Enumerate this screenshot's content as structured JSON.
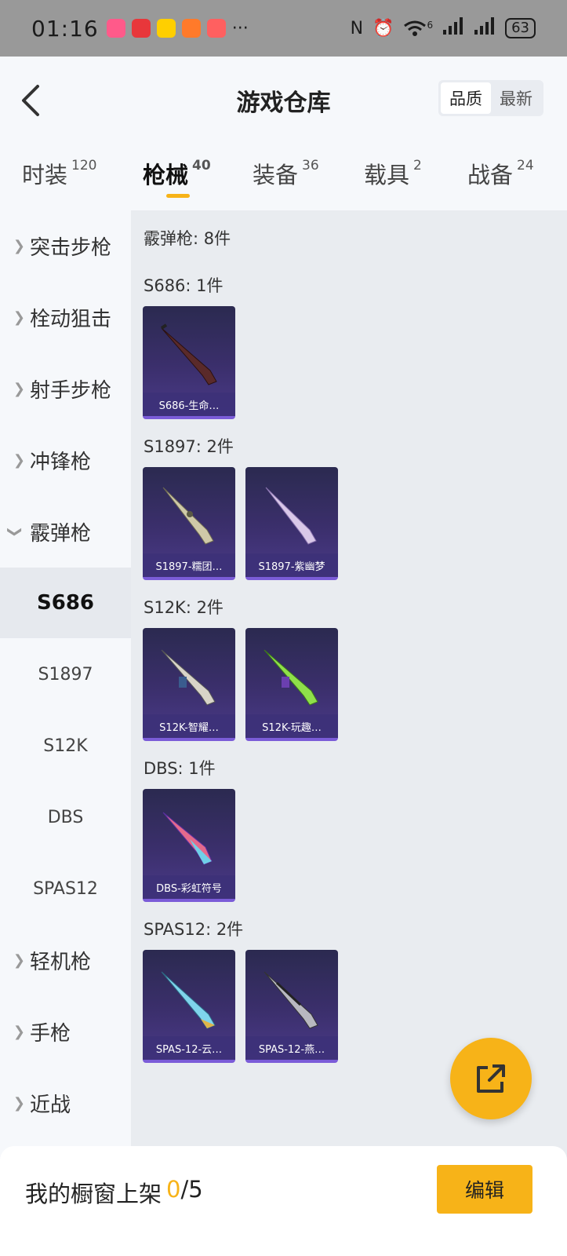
{
  "status_bar": {
    "time": "01:16",
    "more": "···",
    "network_badge": "6",
    "battery": "63",
    "notif_colors": [
      "#ff5a8a",
      "#e8373b",
      "#ffcf00",
      "#ff7a2a",
      "#ff6060"
    ]
  },
  "header": {
    "title": "游戏仓库",
    "sort": {
      "quality": "品质",
      "latest": "最新"
    }
  },
  "tabs": [
    {
      "label": "时装",
      "count": "120"
    },
    {
      "label": "枪械",
      "count": "40",
      "active": true
    },
    {
      "label": "装备",
      "count": "36"
    },
    {
      "label": "载具",
      "count": "2"
    },
    {
      "label": "战备",
      "count": "24"
    }
  ],
  "sidebar": {
    "categories": [
      {
        "label": "突击步枪"
      },
      {
        "label": "栓动狙击"
      },
      {
        "label": "射手步枪"
      },
      {
        "label": "冲锋枪"
      },
      {
        "label": "霰弹枪",
        "expanded": true
      },
      {
        "label": "轻机枪"
      },
      {
        "label": "手枪"
      },
      {
        "label": "近战"
      }
    ],
    "subitems": [
      {
        "label": "S686",
        "active": true
      },
      {
        "label": "S1897"
      },
      {
        "label": "S12K"
      },
      {
        "label": "DBS"
      },
      {
        "label": "SPAS12"
      }
    ]
  },
  "content": {
    "summary": "霰弹枪: 8件",
    "groups": [
      {
        "title": "S686: 1件",
        "items": [
          {
            "name": "S686-生命…"
          }
        ]
      },
      {
        "title": "S1897: 2件",
        "items": [
          {
            "name": "S1897-糯团…"
          },
          {
            "name": "S1897-紫幽梦"
          }
        ]
      },
      {
        "title": "S12K: 2件",
        "items": [
          {
            "name": "S12K-智耀…"
          },
          {
            "name": "S12K-玩趣…"
          }
        ]
      },
      {
        "title": "DBS: 1件",
        "items": [
          {
            "name": "DBS-彩虹符号"
          }
        ]
      },
      {
        "title": "SPAS12: 2件",
        "items": [
          {
            "name": "SPAS-12-云…"
          },
          {
            "name": "SPAS-12-燕…"
          }
        ]
      }
    ]
  },
  "bottom": {
    "showcase_label": "我的橱窗上架",
    "showcase_count": "0",
    "showcase_total": "/5",
    "edit_label": "编辑"
  },
  "colors": {
    "accent": "#f7b318",
    "card_bg": "#3b2f6c",
    "card_border": "#7b5cd8"
  }
}
